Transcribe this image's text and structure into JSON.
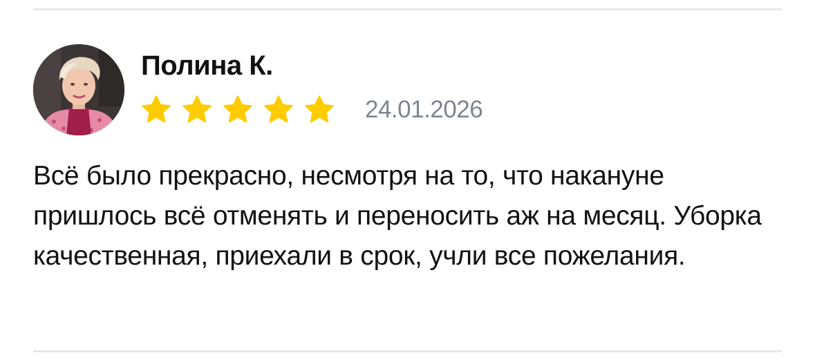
{
  "review": {
    "author": "Полина К.",
    "rating": 5,
    "rating_max": 5,
    "date": "24.01.2026",
    "text": "Всё было прекрасно, несмотря на то, что накануне пришлось всё отменять и переносить аж на месяц. Уборка качественная, приехали в срок, учли все пожелания."
  },
  "colors": {
    "star": "#ffcc00",
    "date": "#7d8591",
    "divider": "#e6e8ec",
    "text": "#111111"
  },
  "icons": {
    "star": "star-icon",
    "avatar": "avatar-photo"
  }
}
